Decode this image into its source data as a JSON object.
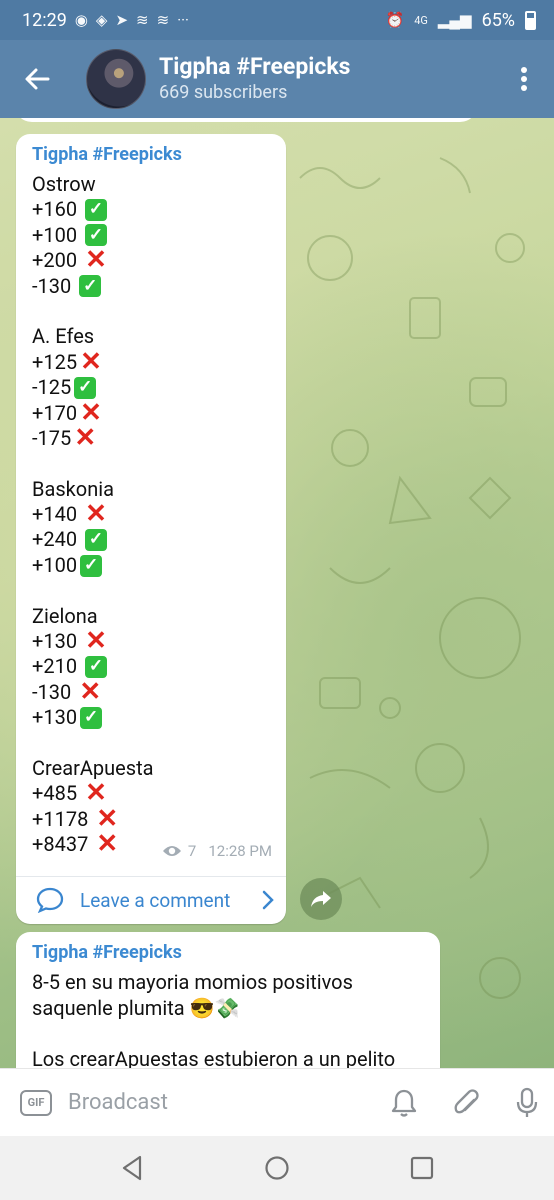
{
  "status_bar": {
    "time": "12:29",
    "battery": "65%",
    "signal_label": "4G",
    "overflow": "···"
  },
  "header": {
    "title": "Tigpha #Freepicks",
    "subtitle": "669 subscribers"
  },
  "messages": [
    {
      "sender": "Tigpha #Freepicks",
      "lines": [
        {
          "text": "Ostrow",
          "mark": ""
        },
        {
          "text": "+160 ",
          "mark": "check"
        },
        {
          "text": "+100 ",
          "mark": "check"
        },
        {
          "text": "+200 ",
          "mark": "cross"
        },
        {
          "text": "-130 ",
          "mark": "check"
        },
        {
          "text": "",
          "mark": ""
        },
        {
          "text": "A. Efes",
          "mark": ""
        },
        {
          "text": "+125",
          "mark": "cross"
        },
        {
          "text": "-125",
          "mark": "check"
        },
        {
          "text": "+170",
          "mark": "cross"
        },
        {
          "text": "-175",
          "mark": "cross"
        },
        {
          "text": "",
          "mark": ""
        },
        {
          "text": "Baskonia",
          "mark": ""
        },
        {
          "text": "+140 ",
          "mark": "cross"
        },
        {
          "text": "+240 ",
          "mark": "check"
        },
        {
          "text": "+100",
          "mark": "check"
        },
        {
          "text": "",
          "mark": ""
        },
        {
          "text": "Zielona",
          "mark": ""
        },
        {
          "text": "+130 ",
          "mark": "cross"
        },
        {
          "text": "+210 ",
          "mark": "check"
        },
        {
          "text": "-130 ",
          "mark": "cross"
        },
        {
          "text": "+130",
          "mark": "check"
        },
        {
          "text": "",
          "mark": ""
        },
        {
          "text": "CrearApuesta",
          "mark": ""
        },
        {
          "text": "+485 ",
          "mark": "cross"
        },
        {
          "text": "+1178 ",
          "mark": "cross"
        },
        {
          "text": "+8437 ",
          "mark": "cross"
        }
      ],
      "views": "7",
      "time": "12:28 PM",
      "comment_label": "Leave a comment"
    },
    {
      "sender": "Tigpha #Freepicks",
      "paragraphs": [
        "8-5 en su mayoria momios positivos saquenle plumita 😎💸",
        "",
        "Los crearApuestas estubieron a un pelito"
      ]
    }
  ],
  "input": {
    "gif_label": "GIF",
    "placeholder": "Broadcast"
  },
  "colors": {
    "header": "#5b84ab",
    "status_bar": "#4f7aa3",
    "accent": "#3c8ad2",
    "check": "#2fbf3f",
    "cross": "#e0261e"
  }
}
